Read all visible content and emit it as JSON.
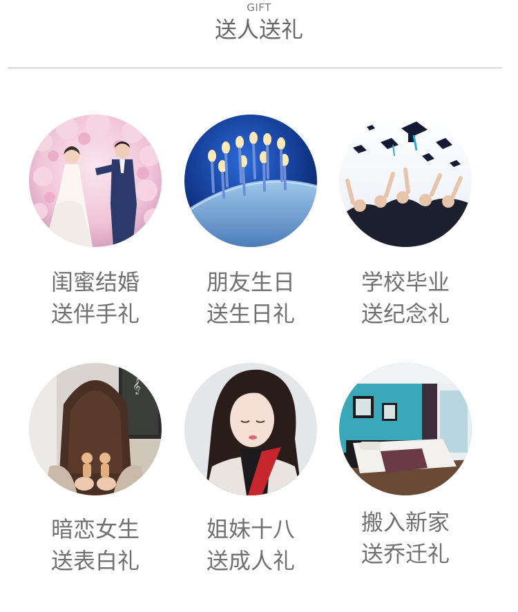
{
  "header": {
    "subtitle": "GIFT",
    "title": "送人送礼"
  },
  "cards": [
    {
      "line1": "闺蜜结婚",
      "line2": "送伴手礼",
      "image": "wedding-couple"
    },
    {
      "line1": "朋友生日",
      "line2": "送生日礼",
      "image": "birthday-candles"
    },
    {
      "line1": "学校毕业",
      "line2": "送纪念礼",
      "image": "graduation-caps"
    },
    {
      "line1": "暗恋女生",
      "line2": "送表白礼",
      "image": "girl-back-view"
    },
    {
      "line1": "姐妹十八",
      "line2": "送成人礼",
      "image": "girl-portrait"
    },
    {
      "line1": "搬入新家",
      "line2": "送乔迁礼",
      "image": "bedroom-interior"
    }
  ]
}
